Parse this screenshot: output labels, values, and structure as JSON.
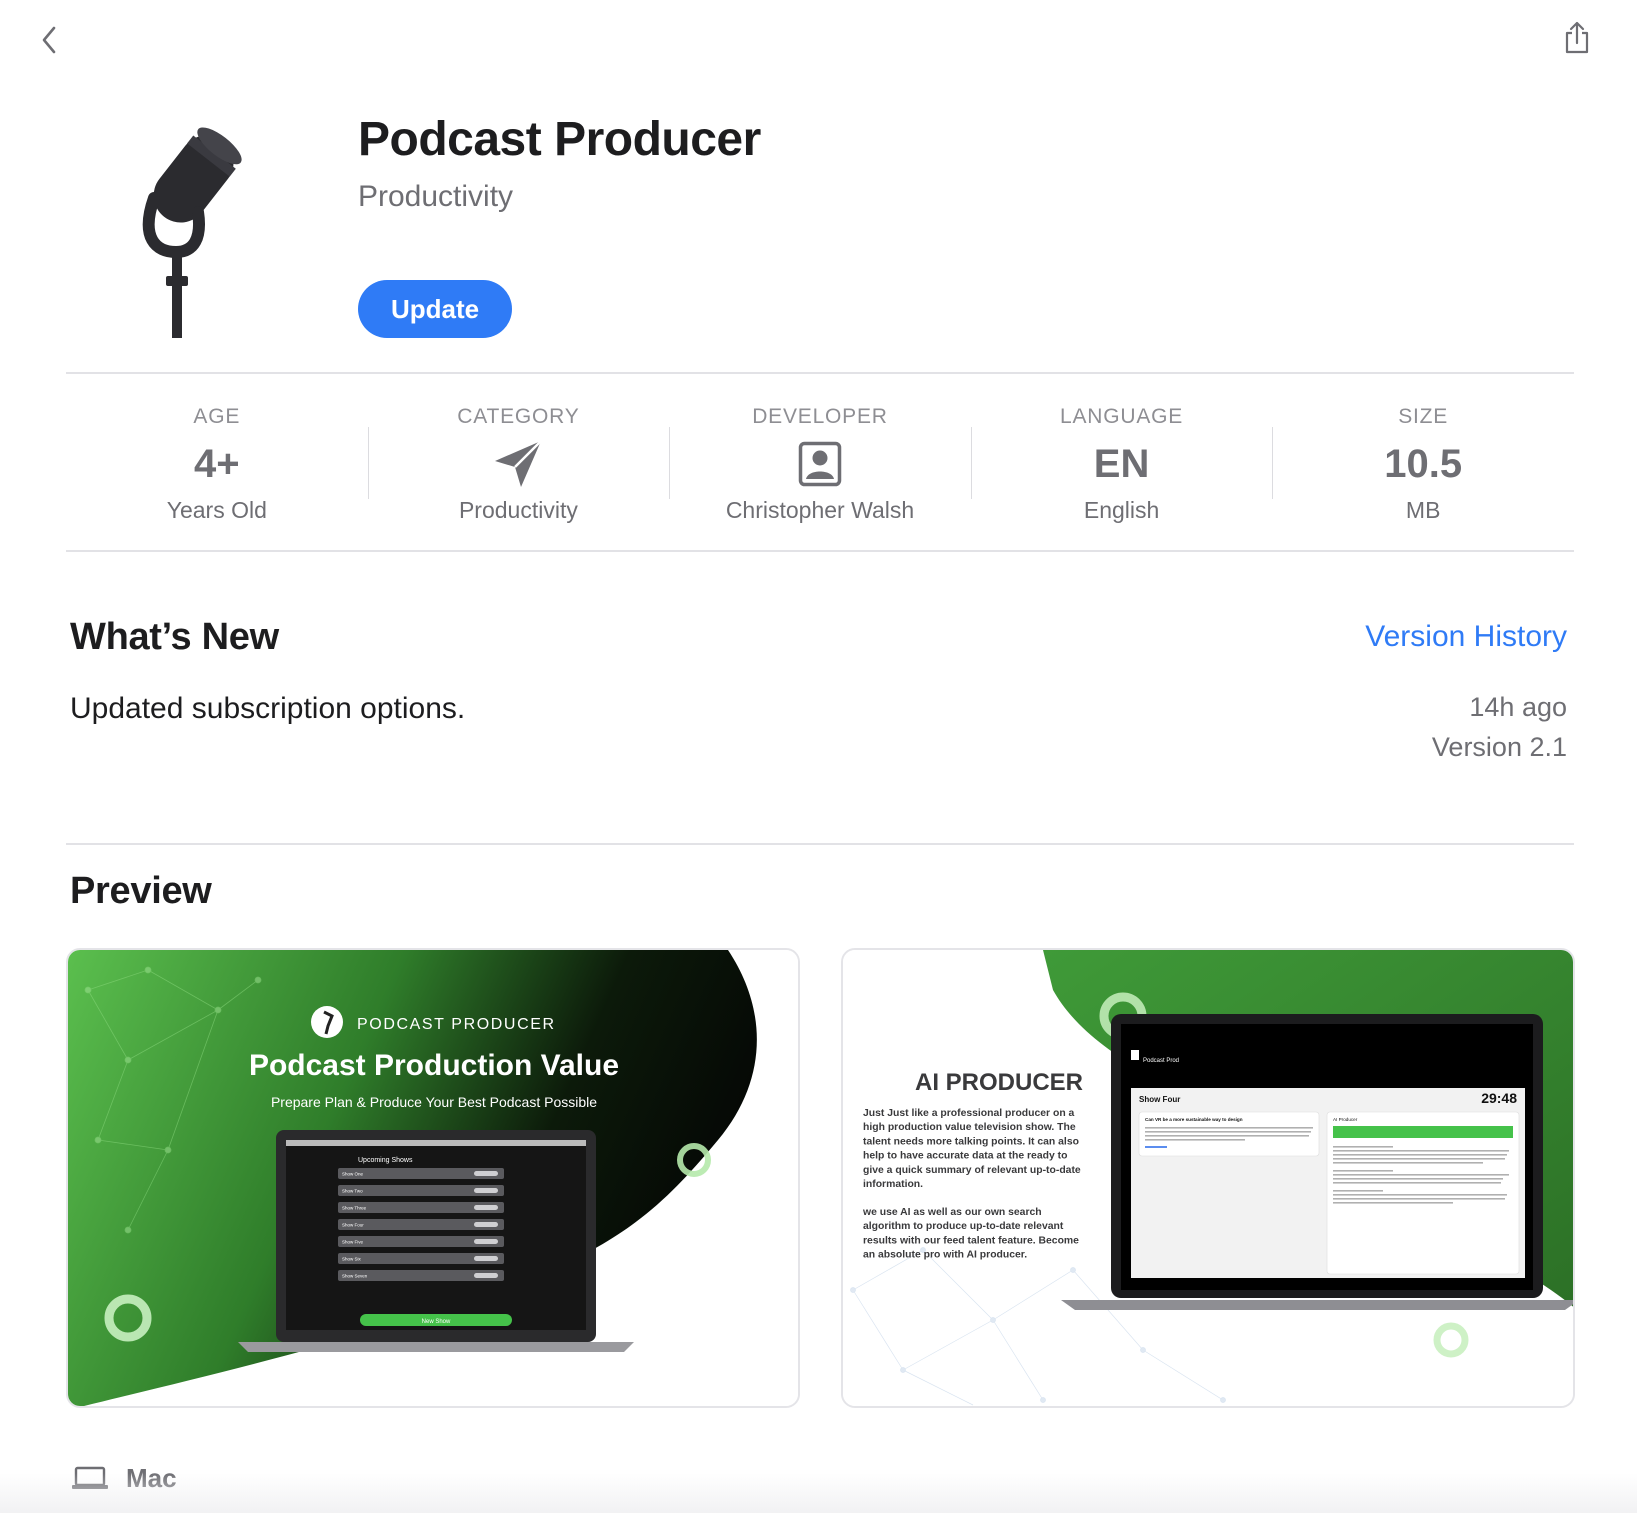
{
  "app": {
    "title": "Podcast Producer",
    "subtitle": "Productivity",
    "update_label": "Update"
  },
  "info": [
    {
      "header": "AGE",
      "value": "4+",
      "sub": "Years Old"
    },
    {
      "header": "CATEGORY",
      "value": "",
      "icon": "paper-plane-icon",
      "sub": "Productivity"
    },
    {
      "header": "DEVELOPER",
      "value": "",
      "icon": "person-icon",
      "sub": "Christopher Walsh"
    },
    {
      "header": "LANGUAGE",
      "value": "EN",
      "sub": "English"
    },
    {
      "header": "SIZE",
      "value": "10.5",
      "sub": "MB"
    }
  ],
  "whats_new": {
    "title": "What’s New",
    "version_history_label": "Version History",
    "text": "Updated subscription options.",
    "ago": "14h ago",
    "version": "Version 2.1"
  },
  "preview": {
    "title": "Preview",
    "shot1": {
      "brand": "PODCAST PRODUCER",
      "headline": "Podcast Production Value",
      "tagline": "Prepare Plan & Produce Your Best Podcast Possible",
      "list_title": "Upcoming Shows",
      "shows": [
        "Show One",
        "Show Two",
        "Show Three",
        "Show Four",
        "Show Five",
        "Show Six",
        "Show Seven"
      ],
      "new_show": "New Show"
    },
    "shot2": {
      "heading": "AI PRODUCER",
      "body1": [
        "Just Just like a professional producer on a",
        "high production value television show. The",
        "talent needs more talking points. It can also",
        "help to have accurate data at the ready to",
        "give a quick summary of relevant up-to-date",
        "information."
      ],
      "body2": [
        " we use AI as well as our own search",
        "algorithm to produce up-to-date relevant",
        "results with our feed talent feature. Become",
        "an absolute pro with AI producer."
      ],
      "screen_app": "Podcast Prod",
      "screen_show": "Show Four",
      "screen_timer": "29:48",
      "card_question": "Can VR be a more sustainable way to design",
      "card_right_title": "AI Producer"
    }
  },
  "platform": {
    "label": "Mac"
  },
  "colors": {
    "accent": "#2f7bf6",
    "green": "#4caf50"
  }
}
